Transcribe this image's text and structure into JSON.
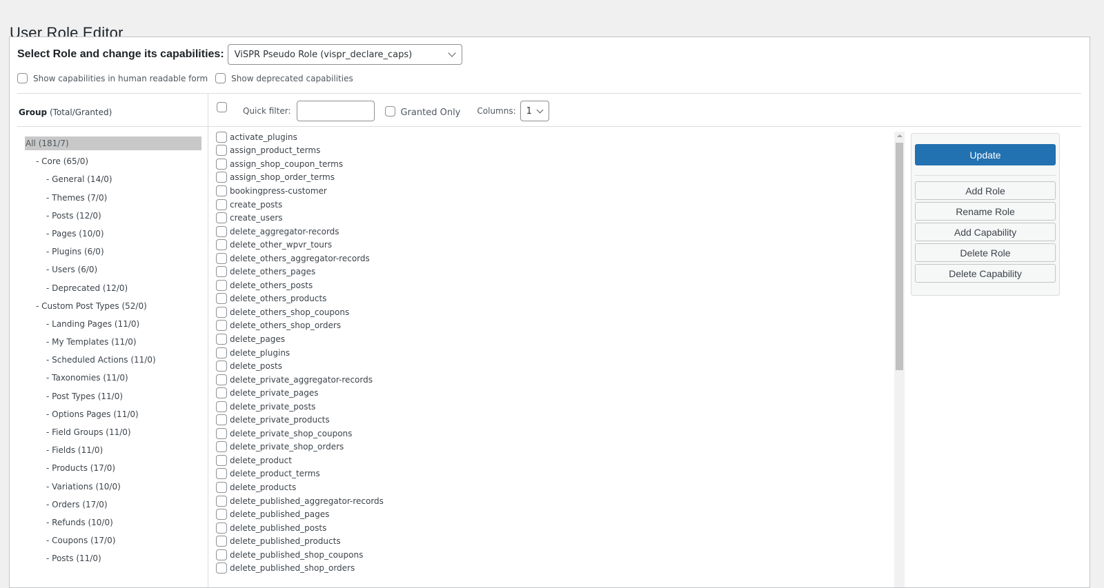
{
  "page": {
    "title": "User Role Editor"
  },
  "role_selector": {
    "label": "Select Role and change its capabilities:",
    "selected": "ViSPR Pseudo Role (vispr_declare_caps)"
  },
  "options": {
    "human_readable": {
      "label": "Show capabilities in human readable form",
      "checked": false
    },
    "deprecated": {
      "label": "Show deprecated capabilities",
      "checked": false
    }
  },
  "groups_header": {
    "title": "Group",
    "subtitle": "(Total/Granted)"
  },
  "filter": {
    "quick_filter_label": "Quick filter:",
    "quick_filter_value": "",
    "granted_only_label": "Granted Only",
    "columns_label": "Columns:",
    "columns_value": "1"
  },
  "groups": [
    {
      "label": "All (181/7)",
      "level": 0,
      "selected": true
    },
    {
      "label": "- Core (65/0)",
      "level": 1
    },
    {
      "label": "- General (14/0)",
      "level": 2
    },
    {
      "label": "- Themes (7/0)",
      "level": 2
    },
    {
      "label": "- Posts (12/0)",
      "level": 2
    },
    {
      "label": "- Pages (10/0)",
      "level": 2
    },
    {
      "label": "- Plugins (6/0)",
      "level": 2
    },
    {
      "label": "- Users (6/0)",
      "level": 2
    },
    {
      "label": "- Deprecated (12/0)",
      "level": 2
    },
    {
      "label": "- Custom Post Types (52/0)",
      "level": 1
    },
    {
      "label": "- Landing Pages (11/0)",
      "level": 2
    },
    {
      "label": "- My Templates (11/0)",
      "level": 2
    },
    {
      "label": "- Scheduled Actions (11/0)",
      "level": 2
    },
    {
      "label": "- Taxonomies (11/0)",
      "level": 2
    },
    {
      "label": "- Post Types (11/0)",
      "level": 2
    },
    {
      "label": "- Options Pages (11/0)",
      "level": 2
    },
    {
      "label": "- Field Groups (11/0)",
      "level": 2
    },
    {
      "label": "- Fields (11/0)",
      "level": 2
    },
    {
      "label": "- Products (17/0)",
      "level": 2
    },
    {
      "label": "- Variations (10/0)",
      "level": 2
    },
    {
      "label": "- Orders (17/0)",
      "level": 2
    },
    {
      "label": "- Refunds (10/0)",
      "level": 2
    },
    {
      "label": "- Coupons (17/0)",
      "level": 2
    },
    {
      "label": "- Posts (11/0)",
      "level": 2
    }
  ],
  "capabilities": [
    "activate_plugins",
    "assign_product_terms",
    "assign_shop_coupon_terms",
    "assign_shop_order_terms",
    "bookingpress-customer",
    "create_posts",
    "create_users",
    "delete_aggregator-records",
    "delete_other_wpvr_tours",
    "delete_others_aggregator-records",
    "delete_others_pages",
    "delete_others_posts",
    "delete_others_products",
    "delete_others_shop_coupons",
    "delete_others_shop_orders",
    "delete_pages",
    "delete_plugins",
    "delete_posts",
    "delete_private_aggregator-records",
    "delete_private_pages",
    "delete_private_posts",
    "delete_private_products",
    "delete_private_shop_coupons",
    "delete_private_shop_orders",
    "delete_product",
    "delete_product_terms",
    "delete_products",
    "delete_published_aggregator-records",
    "delete_published_pages",
    "delete_published_posts",
    "delete_published_products",
    "delete_published_shop_coupons",
    "delete_published_shop_orders"
  ],
  "actions": {
    "update": "Update",
    "add_role": "Add Role",
    "rename_role": "Rename Role",
    "add_capability": "Add Capability",
    "delete_role": "Delete Role",
    "delete_capability": "Delete Capability"
  },
  "colors": {
    "primary": "#2271b1",
    "selected_group_bg": "#c8c8c8",
    "page_bg": "#f0f0f1"
  }
}
